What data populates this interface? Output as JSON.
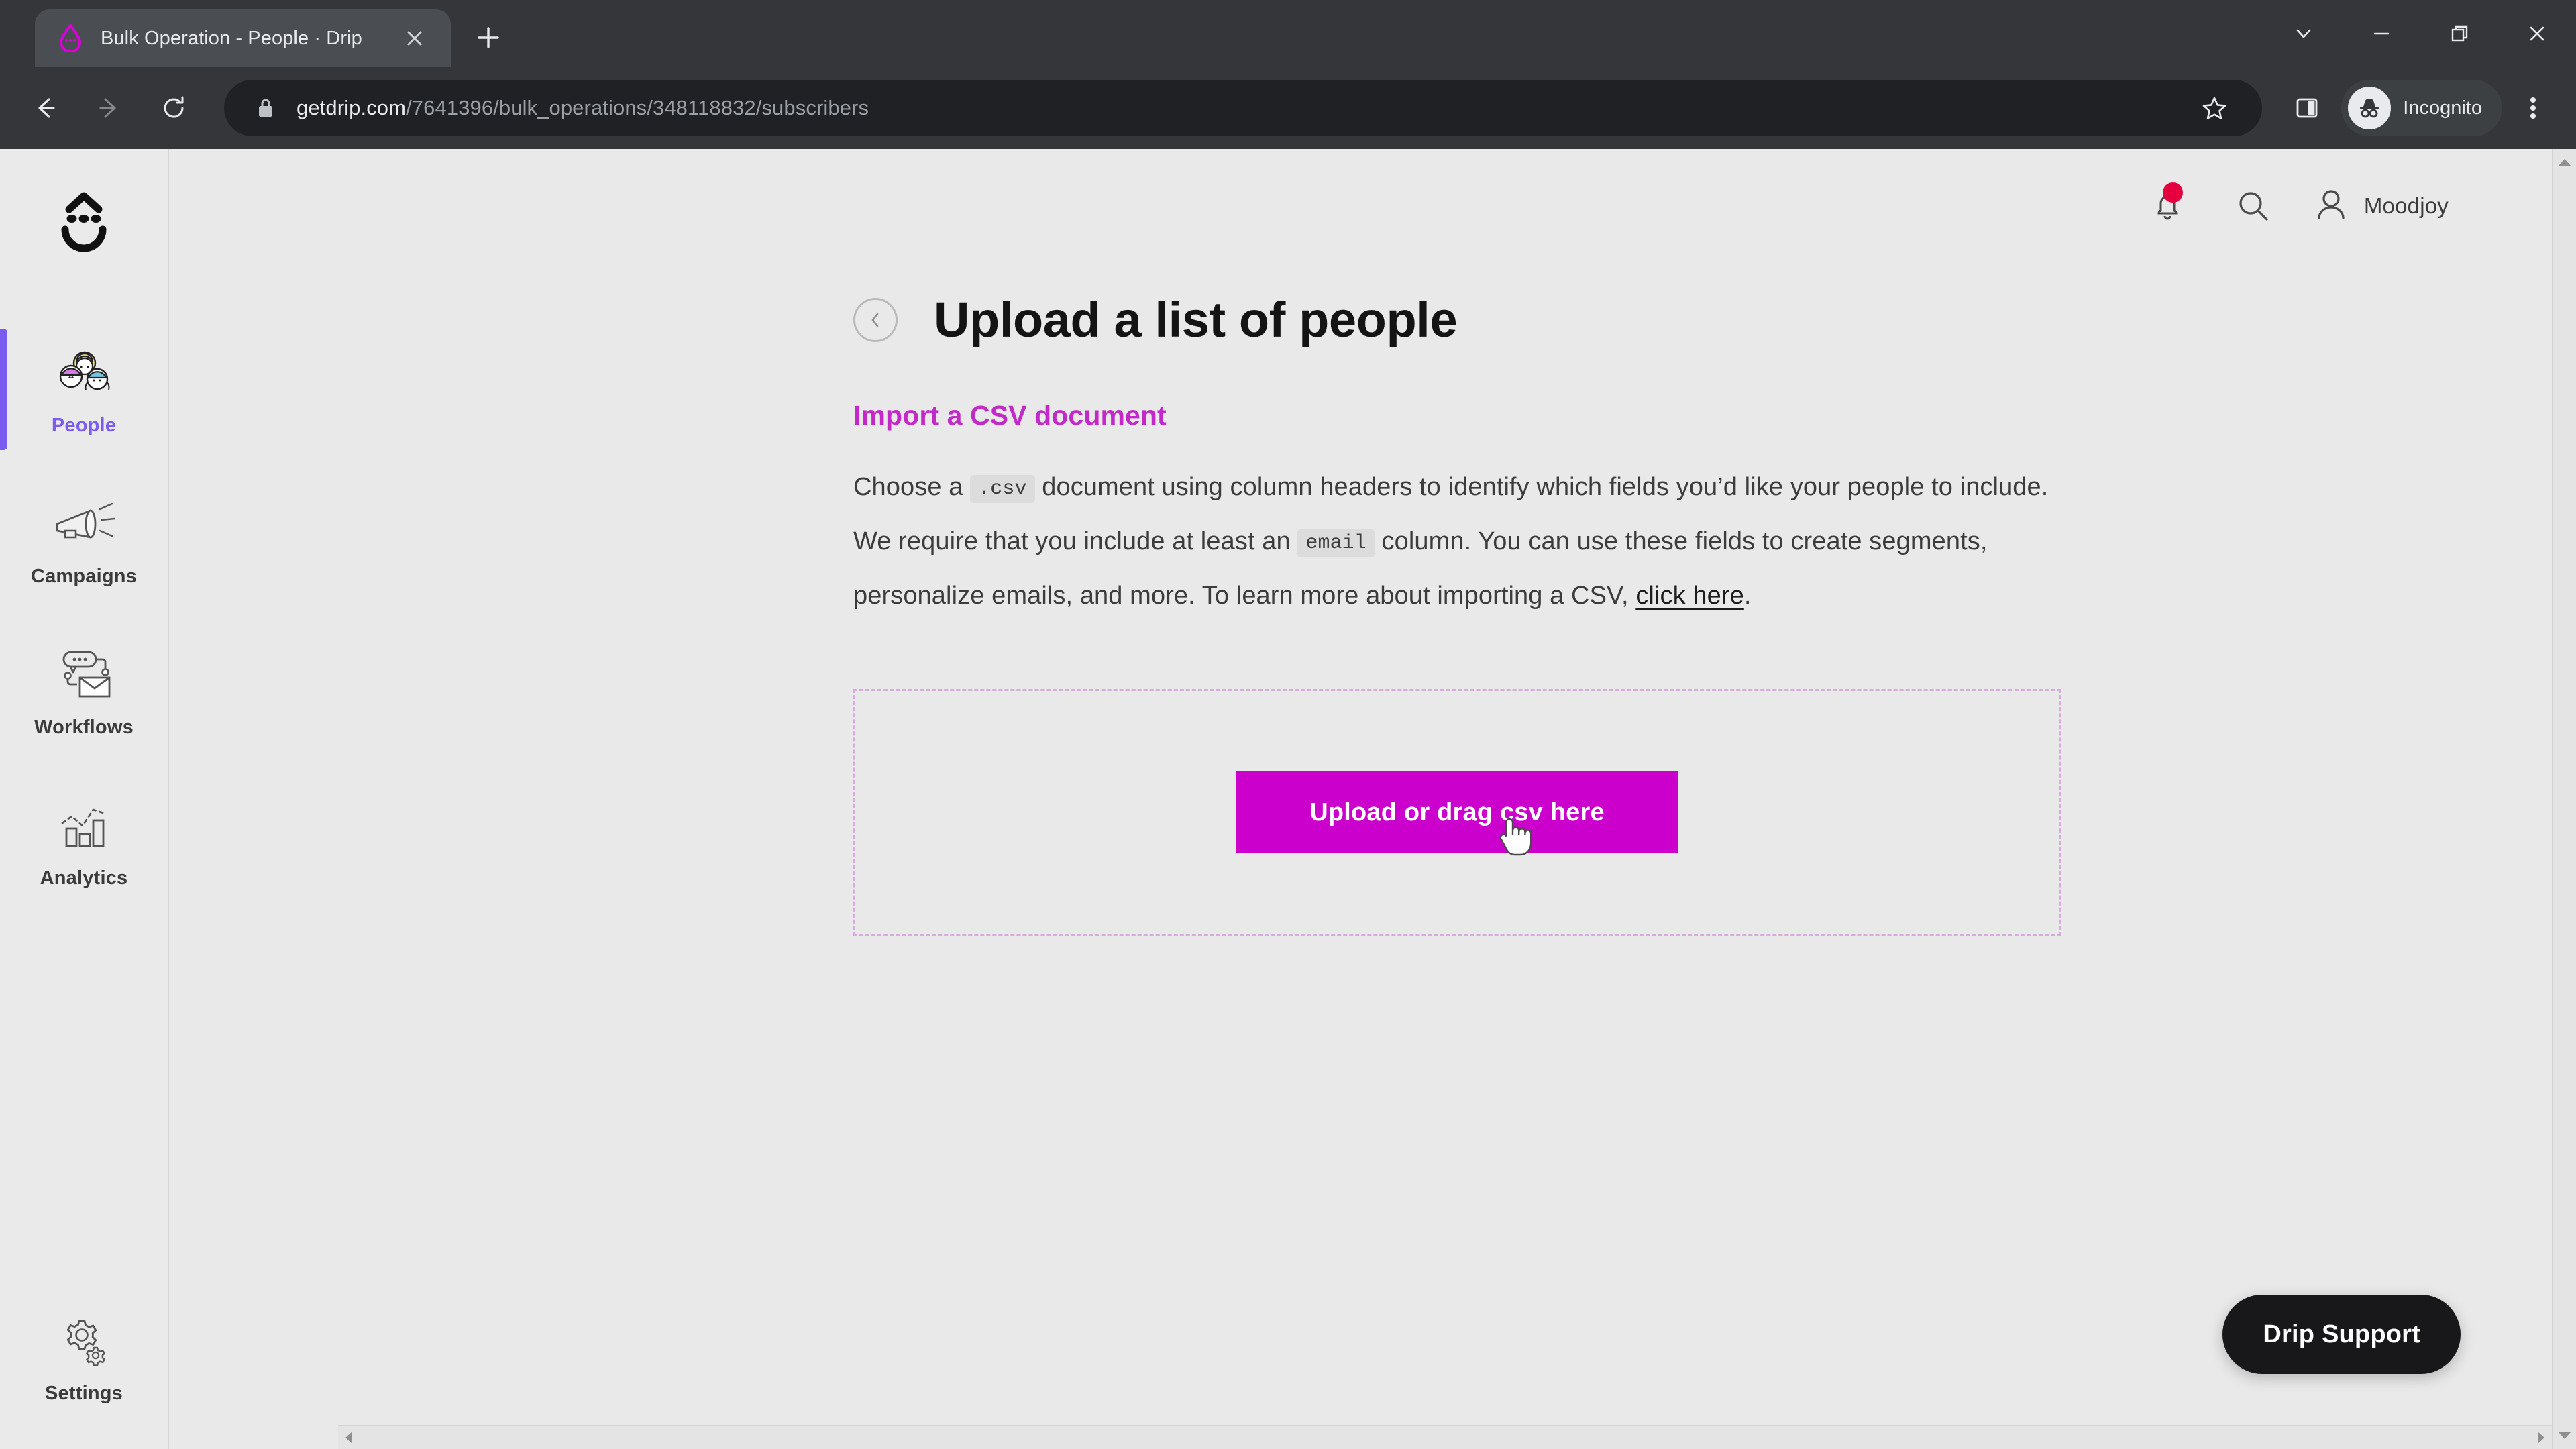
{
  "browser": {
    "tab": {
      "title": "Bulk Operation - People · Drip",
      "favicon_icon": "drip-drop-icon",
      "close_icon": "close-icon"
    },
    "new_tab_icon": "plus-icon",
    "window_controls": [
      {
        "name": "tab-search",
        "icon": "chevron-down-icon"
      },
      {
        "name": "minimize",
        "icon": "minimize-icon"
      },
      {
        "name": "restore",
        "icon": "restore-window-icon"
      },
      {
        "name": "close-window",
        "icon": "close-icon"
      }
    ],
    "toolbar": {
      "back_icon": "back-arrow-icon",
      "forward_icon": "forward-arrow-icon",
      "reload_icon": "reload-icon",
      "lock_icon": "lock-icon",
      "url_host": "getdrip.com",
      "url_path": "/7641396/bulk_operations/348118832/subscribers",
      "url_full": "getdrip.com/7641396/bulk_operations/348118832/subscribers",
      "bookmark_icon": "star-icon",
      "sidepanel_icon": "side-panel-icon",
      "incognito_label": "Incognito",
      "incognito_icon": "incognito-icon",
      "menu_icon": "kebab-menu-icon"
    }
  },
  "app": {
    "brand_icon": "drip-face-logo",
    "sidebar": {
      "items": [
        {
          "label": "People",
          "icon": "people-icon",
          "active": true
        },
        {
          "label": "Campaigns",
          "icon": "megaphone-icon",
          "active": false
        },
        {
          "label": "Workflows",
          "icon": "workflow-icon",
          "active": false
        },
        {
          "label": "Analytics",
          "icon": "bar-chart-icon",
          "active": false
        }
      ],
      "bottom_item": {
        "label": "Settings",
        "icon": "gears-icon",
        "active": false
      },
      "active_accent": "#7b5cf0"
    },
    "header": {
      "notifications_icon": "bell-icon",
      "notifications_badge": true,
      "badge_color": "#e4003e",
      "search_icon": "search-icon",
      "user_icon": "user-avatar-icon",
      "user_name": "Moodjoy"
    },
    "main": {
      "back_icon": "chevron-left-icon",
      "page_title": "Upload a list of people",
      "section_title": "Import a CSV document",
      "section_title_color": "#c328c8",
      "paragraph": {
        "p1": "Choose a ",
        "code1": ".csv",
        "p2": " document using column headers to identify which fields you’d like your people to include. We require that you include at least an ",
        "code2": "email",
        "p3": " column. You can use these fields to create segments, personalize emails, and more. To learn more about importing a CSV, ",
        "link": "click here",
        "p4": "."
      },
      "dropzone": {
        "border_color": "#d8a9dc",
        "upload_button_label": "Upload or drag csv here",
        "upload_button_color": "#cc00cc",
        "cursor_icon": "pointing-hand-cursor"
      }
    },
    "support_button": {
      "label": "Drip Support",
      "color": "#18181a"
    },
    "scrollbars": {
      "vertical_up_icon": "scroll-up-arrow-icon",
      "vertical_down_icon": "scroll-down-arrow-icon",
      "horizontal_left_icon": "scroll-left-arrow-icon",
      "horizontal_right_icon": "scroll-right-arrow-icon"
    }
  }
}
